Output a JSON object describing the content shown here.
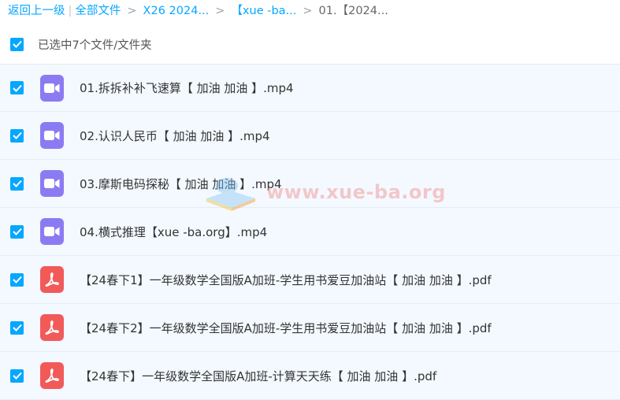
{
  "breadcrumb": {
    "back": "返回上一级",
    "sep_bar": "|",
    "all_files": "全部文件",
    "sep_arrow": ">",
    "crumb1": "X26 2024...",
    "crumb2": "【xue -ba...",
    "current": "01.【2024..."
  },
  "selection": {
    "label": "已选中7个文件/文件夹"
  },
  "files": [
    {
      "name": "01.拆拆补补飞速算【 加油 加油 】.mp4",
      "type": "video",
      "checked": true
    },
    {
      "name": "02.认识人民币【 加油 加油 】.mp4",
      "type": "video",
      "checked": true
    },
    {
      "name": "03.摩斯电码探秘【 加油 加油 】.mp4",
      "type": "video",
      "checked": true
    },
    {
      "name": "04.横式推理【xue -ba.org】.mp4",
      "type": "video",
      "checked": true
    },
    {
      "name": "【24春下1】一年级数学全国版A加班-学生用书爱豆加油站【 加油 加油 】.pdf",
      "type": "pdf",
      "checked": true
    },
    {
      "name": "【24春下2】一年级数学全国版A加班-学生用书爱豆加油站【 加油 加油 】.pdf",
      "type": "pdf",
      "checked": true
    },
    {
      "name": "【24春下】一年级数学全国版A加班-计算天天练【 加油 加油 】.pdf",
      "type": "pdf",
      "checked": true
    }
  ],
  "watermark": {
    "text": "www.xue-ba.org"
  },
  "colors": {
    "accent": "#06a7ff",
    "video": "#8b7bf2",
    "pdf": "#f25a5a",
    "row_bg": "#f4f9ff"
  },
  "icons": {
    "video": "video-camera-icon",
    "pdf": "pdf-icon",
    "check": "checkmark-icon"
  }
}
